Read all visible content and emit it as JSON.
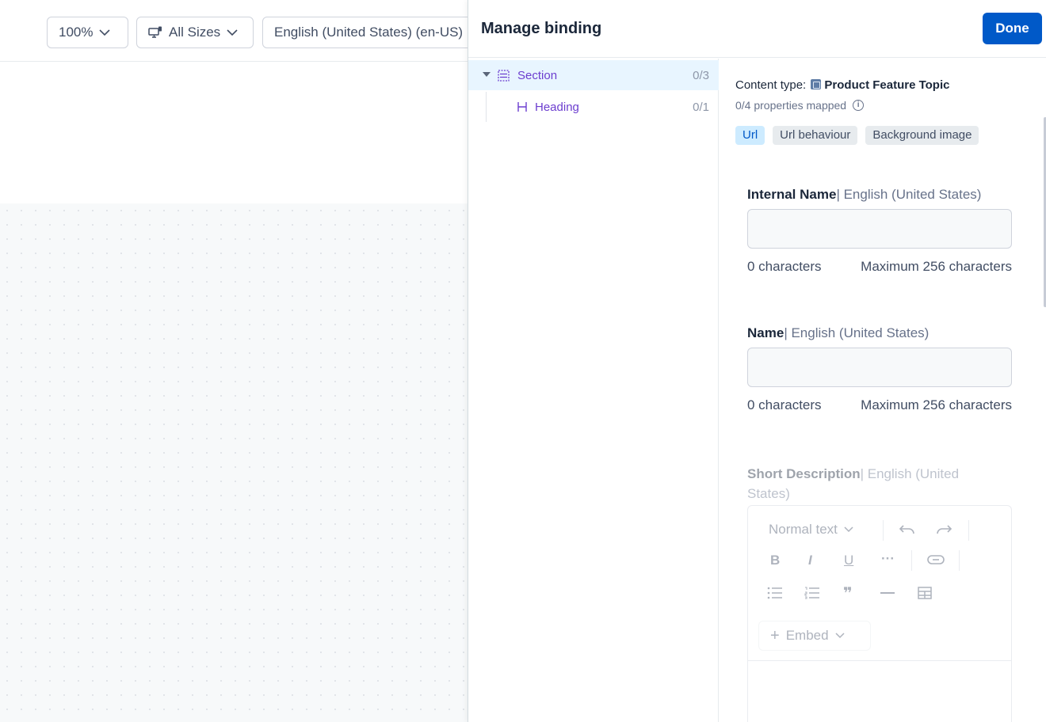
{
  "toolbar": {
    "zoom": "100%",
    "sizes": "All Sizes",
    "locale": "English (United States) (en-US)"
  },
  "panel": {
    "title": "Manage binding",
    "done_label": "Done",
    "tree": [
      {
        "label": "Section",
        "count": "0/3"
      },
      {
        "label": "Heading",
        "count": "0/1"
      }
    ],
    "content_type_prefix": "Content type:",
    "content_type_value": "Product Feature Topic",
    "mapped": "0/4 properties mapped",
    "pills": [
      "Url",
      "Url behaviour",
      "Background image"
    ],
    "fields": [
      {
        "label": "Internal Name",
        "locale": "| English (United States)",
        "chars": "0 characters",
        "max": "Maximum 256 characters"
      },
      {
        "label": "Name",
        "locale": "| English (United States)",
        "chars": "0 characters",
        "max": "Maximum 256 characters"
      }
    ],
    "short_description": {
      "label": "Short Description",
      "locale": "| English (United States)",
      "format": "Normal text",
      "embed": "Embed"
    }
  }
}
